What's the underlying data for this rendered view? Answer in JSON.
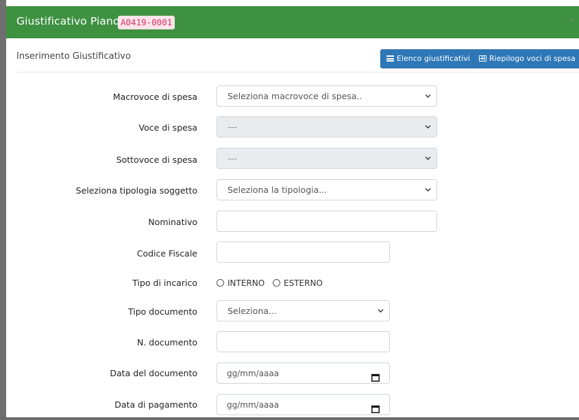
{
  "modal": {
    "title": "Giustificativo Piano",
    "code": "A0419-0001",
    "close_label": "×"
  },
  "subheader": {
    "title": "Inserimento Giustificativo",
    "buttons": {
      "elenco_label": "Elenco giustificativi",
      "riepilogo_label": "Riepilogo voci di spesa"
    }
  },
  "form": {
    "macrovoce": {
      "label": "Macrovoce di spesa",
      "value": "Seleziona macrovoce di spesa.."
    },
    "voce": {
      "label": "Voce di spesa",
      "value": "---"
    },
    "sottovoce": {
      "label": "Sottovoce di spesa",
      "value": "---"
    },
    "tipologia": {
      "label": "Seleziona tipologia soggetto",
      "value": "Seleziona la tipologia..."
    },
    "nominativo": {
      "label": "Nominativo",
      "value": ""
    },
    "codice_fiscale": {
      "label": "Codice Fiscale",
      "value": ""
    },
    "tipo_incarico": {
      "label": "Tipo di incarico",
      "options": [
        "INTERNO",
        "ESTERNO"
      ]
    },
    "tipo_documento": {
      "label": "Tipo documento",
      "value": "Seleziona..."
    },
    "n_documento": {
      "label": "N. documento",
      "value": ""
    },
    "data_documento": {
      "label": "Data del documento",
      "value": "gg/mm/aaaa"
    },
    "data_pagamento": {
      "label": "Data di pagamento",
      "value": "gg/mm/aaaa"
    }
  },
  "colors": {
    "header_green": "#3f9142",
    "button_blue": "#2f78b7",
    "code_red": "#d6336c"
  },
  "icons": [
    "close-icon",
    "list-icon",
    "table-icon",
    "chevron-down-icon",
    "calendar-icon",
    "radio-icon"
  ]
}
